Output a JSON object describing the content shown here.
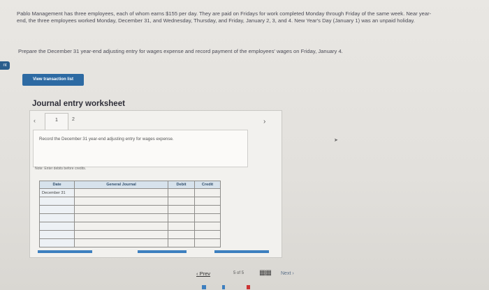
{
  "problem": {
    "text": "Pablo Management has three employees, each of whom earns $155 per day. They are paid on Fridays for work completed Monday through Friday of the same week. Near year-end, the three employees worked Monday, December 31, and Wednesday, Thursday, and Friday, January 2, 3, and 4. New Year's Day (January 1) was an unpaid holiday.",
    "prompt": "Prepare the December 31 year-end adjusting entry for wages expense and record payment of the employees' wages on Friday, January 4."
  },
  "sidebar": {
    "tab_label": "nt"
  },
  "buttons": {
    "view_transaction_list": "View transaction list"
  },
  "worksheet": {
    "title": "Journal entry worksheet",
    "tabs": [
      "1",
      "2"
    ],
    "instruction": "Record the December 31 year-end adjusting entry for wages expense.",
    "note": "Note: Enter debits before credits.",
    "table": {
      "headers": [
        "Date",
        "General Journal",
        "Debit",
        "Credit"
      ],
      "rows": [
        [
          "December 31",
          "",
          "",
          ""
        ],
        [
          "",
          "",
          "",
          ""
        ],
        [
          "",
          "",
          "",
          ""
        ],
        [
          "",
          "",
          "",
          ""
        ],
        [
          "",
          "",
          "",
          ""
        ],
        [
          "",
          "",
          "",
          ""
        ],
        [
          "",
          "",
          "",
          ""
        ]
      ]
    }
  },
  "pagination": {
    "prev_label": "Prev",
    "current": "5",
    "of_label": "of",
    "total": "5",
    "next_label": "Next"
  },
  "icons": {
    "prev": "chevron-left-icon",
    "next": "chevron-right-icon",
    "grid": "grid-icon",
    "cursor": "mouse-cursor-icon"
  },
  "colors": {
    "accent": "#2d6aa3",
    "header_bg": "#d7e2ec"
  }
}
